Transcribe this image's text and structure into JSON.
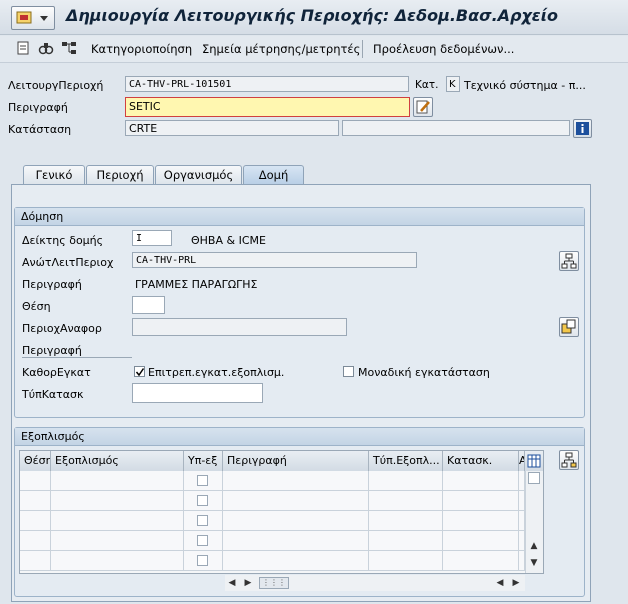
{
  "window": {
    "title": "Δημιουργία Λειτουργικής Περιοχής: Δεδομ.Βασ.Αρχείο"
  },
  "toolbar": {
    "items": [
      {
        "label": "Κατηγοριοποίηση"
      },
      {
        "label": "Σημεία μέτρησης/μετρητές"
      },
      {
        "label": "Προέλευση δεδομένων..."
      }
    ]
  },
  "header": {
    "funcloc_label": "ΛειτουργΠεριοχή",
    "funcloc_value": "CA-THV-PRL-101501",
    "kat_label": "Κατ.",
    "kat_value": "K",
    "kat_text": "Τεχνικό σύστημα - π...",
    "desc_label": "Περιγραφή",
    "desc_value": "SETIC",
    "status_label": "Κατάσταση",
    "status_value": "CRTE"
  },
  "tabs": [
    {
      "label": "Γενικό"
    },
    {
      "label": "Περιοχή"
    },
    {
      "label": "Οργανισμός"
    },
    {
      "label": "Δομή"
    }
  ],
  "structure": {
    "title": "Δόμηση",
    "indicator_label": "Δείκτης δομής",
    "indicator_value": "I",
    "indicator_text": "ΘΗΒΑ & ICME",
    "superior_label": "ΑνώτΛειτΠεριοχ",
    "superior_value": "CA-THV-PRL",
    "superior_desc_label": "Περιγραφή",
    "superior_desc_value": "ΓΡΑΜΜΕΣ ΠΑΡΑΓΩΓΗΣ",
    "position_label": "Θέση",
    "position_value": "",
    "refloc_label": "ΠεριοχΑναφορ",
    "refloc_value": "",
    "refdesc_label": "Περιγραφή",
    "refdesc_value": "",
    "install_label": "ΚαθορΕγκατ",
    "install_allowed_label": "Επιτρεπ.εγκατ.εξοπλισμ.",
    "install_allowed": true,
    "single_install_label": "Μοναδική εγκατάσταση",
    "single_install": false,
    "constype_label": "ΤύπΚατασκ",
    "constype_value": ""
  },
  "equipment": {
    "title": "Εξοπλισμός",
    "columns": [
      "Θέση",
      "Εξοπλισμός",
      "Υπ-εξ",
      "Περιγραφή",
      "Τύπ.Εξοπλ...",
      "Κατασκ.",
      "A"
    ],
    "rows": 5
  }
}
